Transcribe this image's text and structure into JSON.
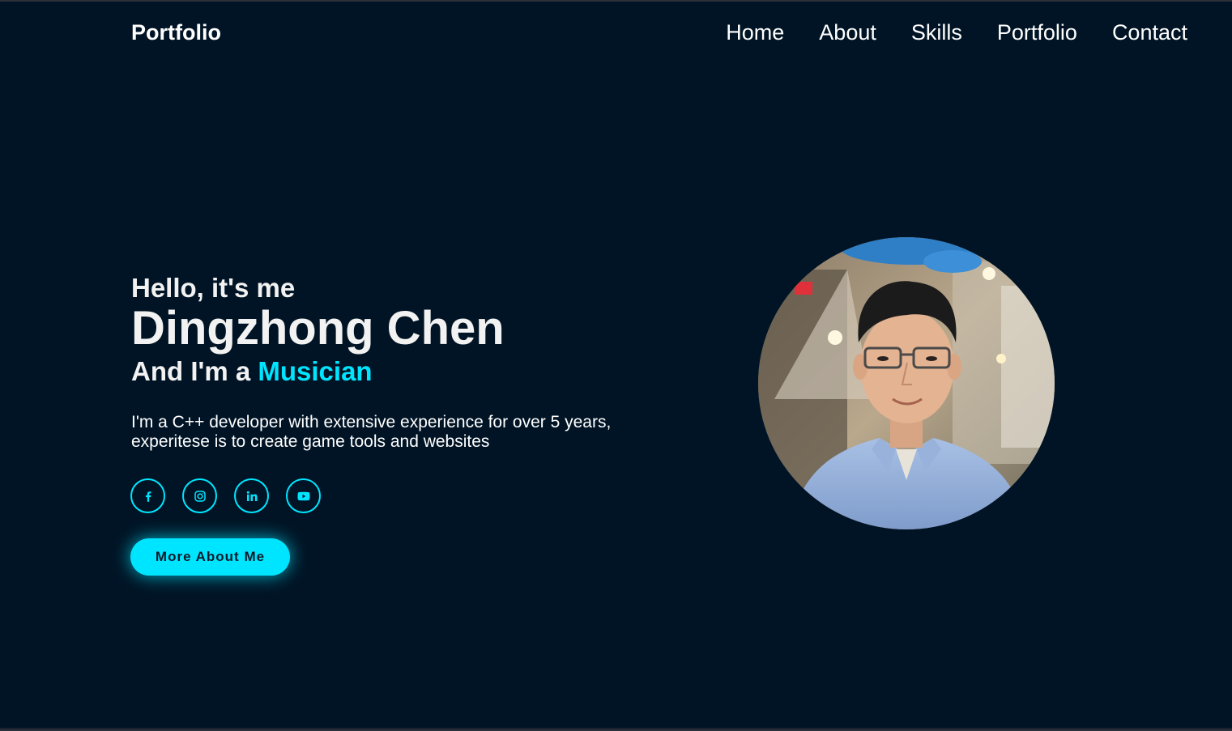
{
  "header": {
    "logo": "Portfolio",
    "nav": [
      "Home",
      "About",
      "Skills",
      "Portfolio",
      "Contact"
    ]
  },
  "hero": {
    "greeting": "Hello, it's me",
    "name": "Dingzhong Chen",
    "role_prefix": "And I'm a",
    "role_highlight": "Musician",
    "description_line1": "I'm a C++ developer with extensive experience for over 5 years,",
    "description_line2": "experitese is to create game tools and websites",
    "socials": [
      "facebook-icon",
      "instagram-icon",
      "linkedin-icon",
      "youtube-icon"
    ],
    "cta_label": "More About Me"
  },
  "colors": {
    "background": "#011425",
    "accent": "#00e5ff",
    "text": "#ffffff"
  }
}
